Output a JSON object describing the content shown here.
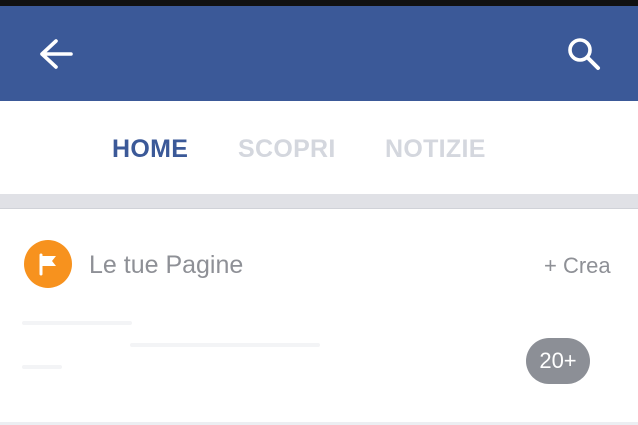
{
  "header": {
    "back_icon": "arrow-left-icon",
    "search_icon": "search-icon",
    "background_color": "#3b5998"
  },
  "tabs": [
    {
      "label": "HOME",
      "active": true
    },
    {
      "label": "SCOPRI",
      "active": false
    },
    {
      "label": "NOTIZIE",
      "active": false
    }
  ],
  "pages_section": {
    "icon": "flag-icon",
    "icon_color": "#f7921e",
    "title": "Le tue Pagine",
    "create_label": "+ Crea",
    "count_badge": "20+"
  }
}
